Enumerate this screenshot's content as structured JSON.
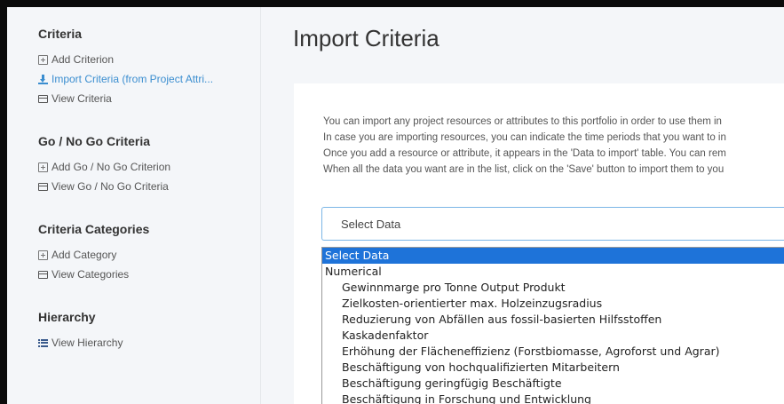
{
  "sidebar": {
    "sections": [
      {
        "heading": "Criteria",
        "links": [
          {
            "label": "Add Criterion",
            "icon": "plus-square-icon"
          },
          {
            "label": "Import Criteria (from Project Attri...",
            "icon": "download-icon"
          },
          {
            "label": "View Criteria",
            "icon": "list-icon"
          }
        ]
      },
      {
        "heading": "Go / No Go Criteria",
        "links": [
          {
            "label": "Add Go / No Go Criterion",
            "icon": "plus-square-icon"
          },
          {
            "label": "View Go / No Go Criteria",
            "icon": "list-icon"
          }
        ]
      },
      {
        "heading": "Criteria Categories",
        "links": [
          {
            "label": "Add Category",
            "icon": "plus-square-icon"
          },
          {
            "label": "View Categories",
            "icon": "list-icon"
          }
        ]
      },
      {
        "heading": "Hierarchy",
        "links": [
          {
            "label": "View Hierarchy",
            "icon": "hierarchy-list-icon"
          }
        ]
      }
    ]
  },
  "main": {
    "title": "Import Criteria",
    "intro_lines": [
      "You can import any project resources or attributes to this portfolio in order to use them in",
      "In case you are importing resources, you can indicate the time periods that you want to in",
      "Once you add a resource or attribute, it appears in the 'Data to import' table. You can rem",
      "When all the data you want are in the list, click on the 'Save' button to import them to you"
    ],
    "select": {
      "value": "Select Data",
      "options": [
        {
          "label": "Select Data",
          "type": "option",
          "selected": true
        },
        {
          "label": "Numerical",
          "type": "group"
        },
        {
          "label": "Gewinnmarge pro Tonne Output Produkt",
          "type": "option"
        },
        {
          "label": "Zielkosten-orientierter max. Holzeinzugsradius",
          "type": "option"
        },
        {
          "label": "Reduzierung von Abfällen aus fossil-basierten Hilfsstoffen",
          "type": "option"
        },
        {
          "label": "Kaskadenfaktor",
          "type": "option"
        },
        {
          "label": "Erhöhung der Flächeneffizienz (Forstbiomasse, Agroforst und Agrar)",
          "type": "option"
        },
        {
          "label": "Beschäftigung von hochqualifizierten Mitarbeitern",
          "type": "option"
        },
        {
          "label": "Beschäftigung geringfügig Beschäftigte",
          "type": "option"
        },
        {
          "label": "Beschäftigung in Forschung und Entwicklung",
          "type": "option"
        }
      ]
    }
  },
  "colors": {
    "link_active": "#3b8ed0",
    "selected_option_bg": "#1e73d9",
    "select_border": "#7bb6e6"
  }
}
